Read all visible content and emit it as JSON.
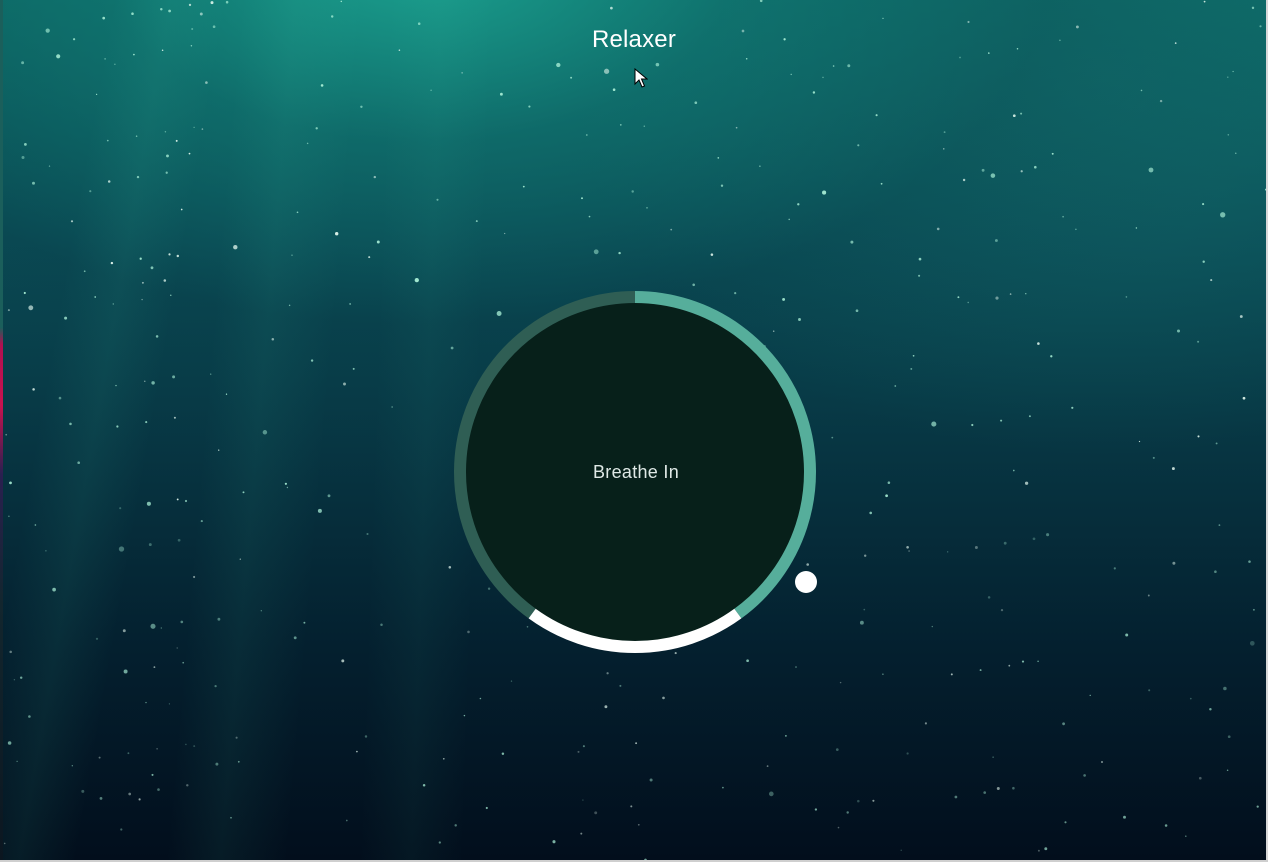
{
  "app": {
    "title": "Relaxer"
  },
  "breathing": {
    "instruction": "Breathe In",
    "colors": {
      "disc": "#07201a",
      "ring_breathe": "#56ae9b",
      "ring_hold": "#ffffff",
      "ring_out": "#2f5e54",
      "pointer": "#ffffff"
    }
  },
  "icons": {
    "cursor": "mouse-pointer-icon"
  }
}
